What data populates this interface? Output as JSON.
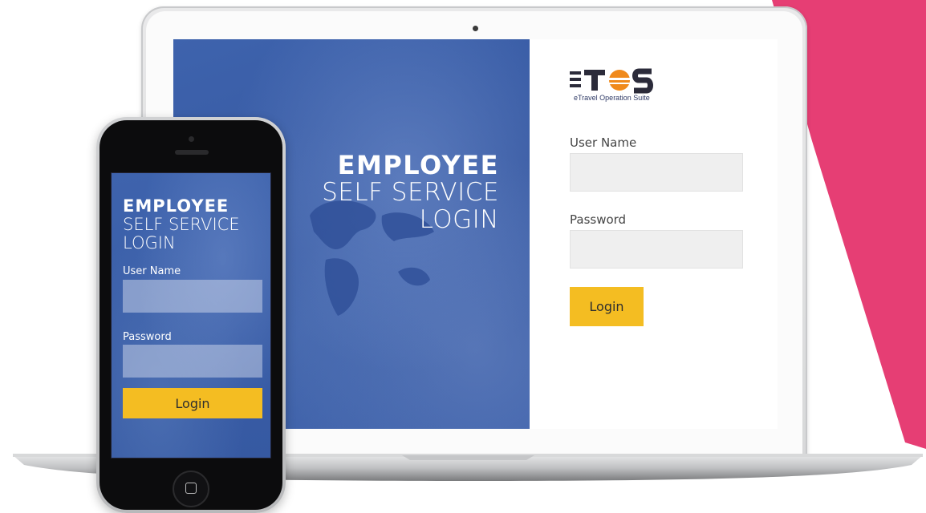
{
  "colors": {
    "accent_pink": "#e63e74",
    "panel_blue": "#3a5ea8",
    "button_yellow": "#f4bd22",
    "logo_orange": "#f08a1c",
    "logo_dark": "#2b2b3a"
  },
  "laptop": {
    "hero": {
      "line1": "EMPLOYEE",
      "line2": "SELF SERVICE",
      "line3": "LOGIN"
    },
    "logo": {
      "text": "eTOS",
      "tagline": "eTravel Operation Suite"
    },
    "form": {
      "username_label": "User Name",
      "username_value": "",
      "password_label": "Password",
      "password_value": "",
      "login_label": "Login"
    }
  },
  "phone": {
    "hero": {
      "line1": "EMPLOYEE",
      "line2": "SELF SERVICE",
      "line3": "LOGIN"
    },
    "form": {
      "username_label": "User Name",
      "username_value": "",
      "password_label": "Password",
      "password_value": "",
      "login_label": "Login"
    }
  },
  "icons": {
    "home_button": "square-home-icon",
    "world_map": "world-map-icon"
  }
}
